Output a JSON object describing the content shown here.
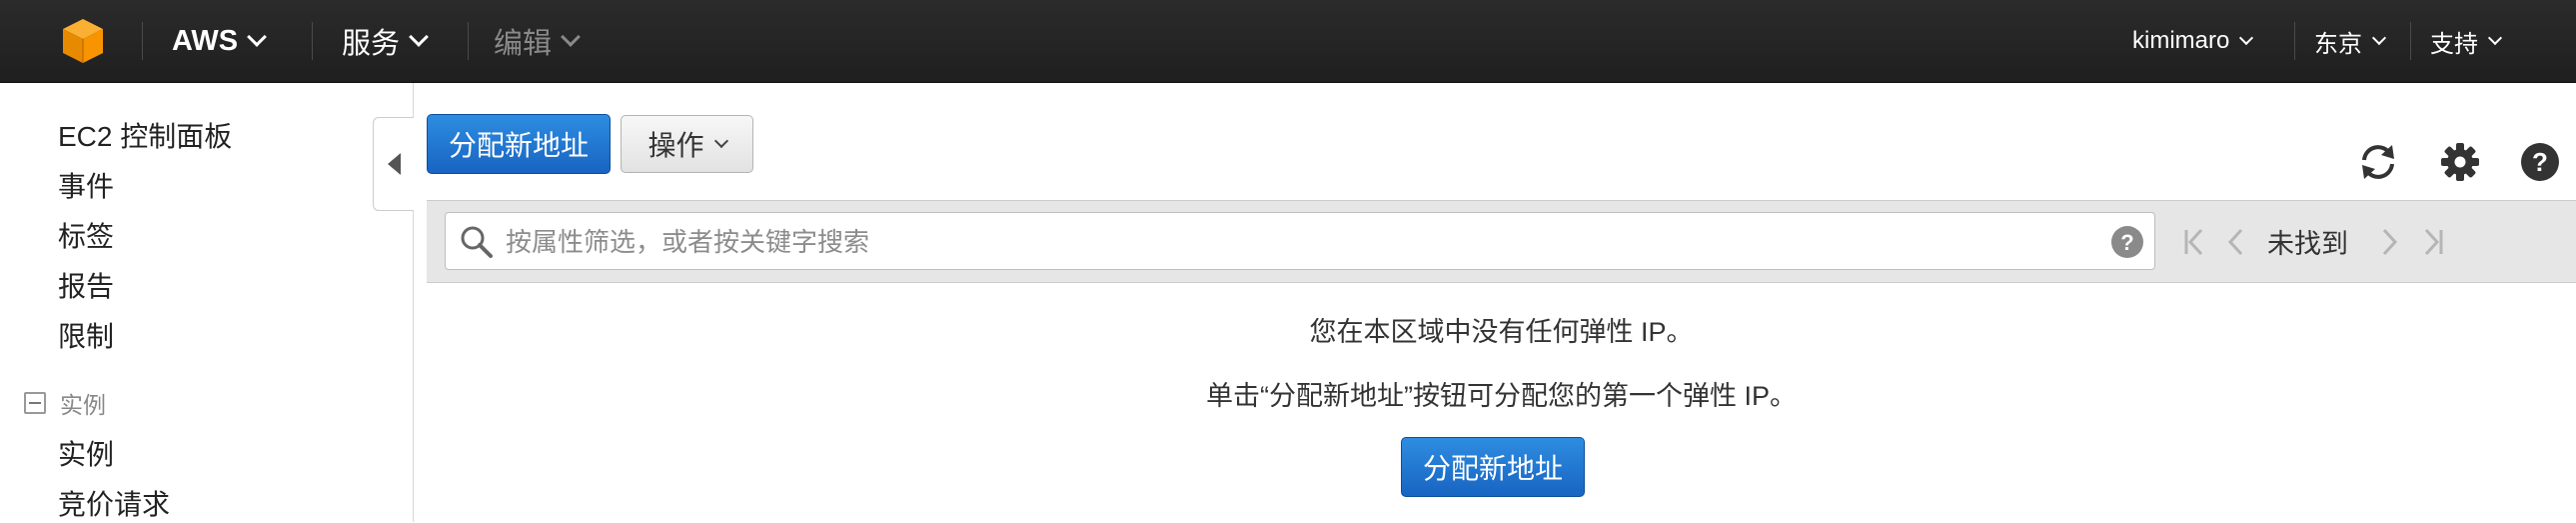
{
  "topbar": {
    "logo_icon": "aws-cube-icon",
    "brand": "AWS",
    "services": "服务",
    "edit": "编辑",
    "user": "kimimaro",
    "region": "东京",
    "support": "支持"
  },
  "sidebar": {
    "items": [
      "EC2 控制面板",
      "事件",
      "标签",
      "报告",
      "限制"
    ],
    "section_title": "实例",
    "section_items": [
      "实例",
      "竞价请求"
    ]
  },
  "toolbar": {
    "allocate_label": "分配新地址",
    "actions_label": "操作",
    "refresh_icon": "refresh-icon",
    "settings_icon": "gear-icon",
    "help_icon": "help-icon"
  },
  "filter": {
    "placeholder": "按属性筛选，或者按关键字搜索",
    "value": ""
  },
  "pager": {
    "status": "未找到"
  },
  "empty_state": {
    "message": "您在本区域中没有任何弹性 IP。",
    "hint": "单击“分配新地址”按钮可分配您的第一个弹性 IP。",
    "button_label": "分配新地址"
  },
  "colors": {
    "topbar_bg": "#232323",
    "primary_button": "#1f73cf",
    "logo_orange": "#f79400"
  }
}
